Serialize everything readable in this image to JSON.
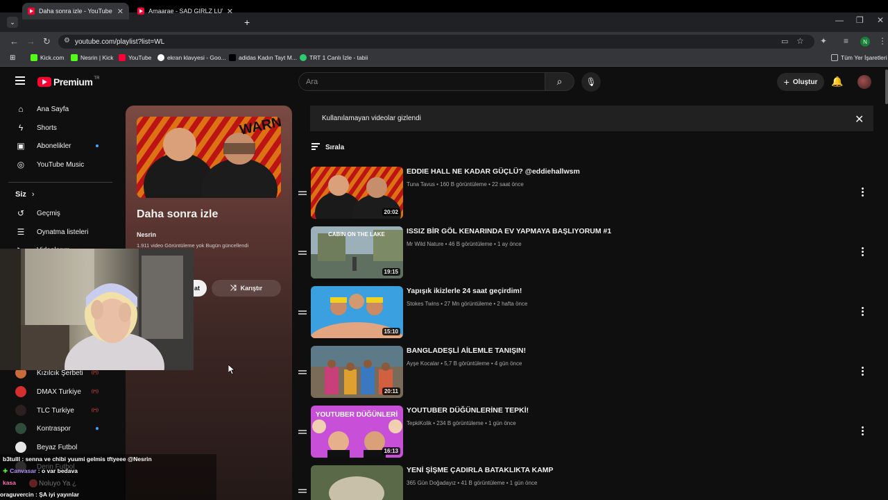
{
  "browser": {
    "tabs": [
      {
        "title": "Daha sonra izle - YouTube",
        "active": true
      },
      {
        "title": "Amaarae - SAD GIRLZ LUV MO",
        "active": false
      }
    ],
    "url": "youtube.com/playlist?list=WL",
    "bookmarks": [
      "Kick.com",
      "Nesrin | Kick",
      "YouTube",
      "ekran klavyesi - Goo...",
      "adidas Kadın Tayt M...",
      "TRT 1 Canlı İzle - tabii"
    ],
    "all_bookmarks": "Tüm Yer İşaretleri",
    "profile_initial": "N"
  },
  "header": {
    "logo_text": "Premium",
    "country": "TR",
    "search_placeholder": "Ara",
    "create_label": "Oluştur"
  },
  "sidebar": {
    "main": [
      {
        "label": "Ana Sayfa",
        "icon": "home-icon"
      },
      {
        "label": "Shorts",
        "icon": "shorts-icon"
      },
      {
        "label": "Abonelikler",
        "icon": "subscriptions-icon"
      },
      {
        "label": "YouTube Music",
        "icon": "music-icon"
      }
    ],
    "you_heading": "Siz",
    "you": [
      {
        "label": "Geçmiş",
        "icon": "history-icon"
      },
      {
        "label": "Oynatma listeleri",
        "icon": "playlists-icon"
      },
      {
        "label": "Videolarım",
        "icon": "videos-icon"
      }
    ],
    "subscriptions": [
      {
        "label": "Kızılcık Şerbeti",
        "badge": "live"
      },
      {
        "label": "DMAX Turkiye",
        "badge": "live"
      },
      {
        "label": "TLC Turkiye",
        "badge": "live"
      },
      {
        "label": "Kontraspor",
        "badge": "dot"
      },
      {
        "label": "Beyaz Futbol",
        "badge": ""
      },
      {
        "label": "Derin Futbol",
        "badge": ""
      },
      {
        "label": "Noluyo Ya ¿",
        "badge": ""
      }
    ]
  },
  "playlist": {
    "title": "Daha sonra izle",
    "owner": "Nesrin",
    "meta": "1.911 video  Görüntüleme yok  Bugün güncellendi",
    "play_all": "at",
    "shuffle": "Karıştır"
  },
  "notice": "Kullanılamayan videolar gizlendi",
  "sort_label": "Sırala",
  "videos": [
    {
      "title": "EDDIE HALL NE KADAR GÜÇLÜ? @eddiehallwsm",
      "meta": "Tuna Tavus • 160 B görüntüleme • 22 saat önce",
      "duration": "20:02",
      "thumb": "warning"
    },
    {
      "title": "ISSIZ BİR GÖL KENARINDA EV YAPMAYA BAŞLIYORUM #1",
      "meta": "Mr Wild Nature • 46 B görüntüleme • 1 ay önce",
      "duration": "19:15",
      "thumb": "lake"
    },
    {
      "title": "Yapışık ikizlerle 24 saat geçirdim!",
      "meta": "Stokes Twins • 27 Mn görüntüleme • 2 hafta önce",
      "duration": "15:10",
      "thumb": "sky"
    },
    {
      "title": "BANGLADEŞLİ AİLEMLE TANIŞIN!",
      "meta": "Ayşe Kocalar • 5,7 B görüntüleme • 4 gün önce",
      "duration": "20:11",
      "thumb": "family"
    },
    {
      "title": "YOUTUBER DÜĞÜNLERİNE TEPKİ!",
      "meta": "TepkiKolik • 234 B görüntüleme • 1 gün önce",
      "duration": "16:13",
      "thumb": "pink"
    },
    {
      "title": "YENİ ŞİŞME ÇADIRLA BATAKLIKTA KAMP",
      "meta": "365 Gün Doğadayız • 41 B görüntüleme • 1 gün önce",
      "duration": "",
      "thumb": "green"
    }
  ],
  "chat": [
    {
      "user": "b3tulll",
      "text": " : senna ve chibi yuumi gelmis tftyeee @Nesrin",
      "color": "#ffffff"
    },
    {
      "user": "Canvasar",
      "text": " : o var bedava",
      "color": "#b68cff"
    },
    {
      "user": "kasa",
      "text": "",
      "color": "#ff6fb5"
    },
    {
      "user": "oraguvercin",
      "text": " : ŞA  iyi yayınlar",
      "color": "#ffffff"
    }
  ],
  "thumb_text": {
    "warning": "WARNING",
    "lake": "CABIN ON THE LAKE",
    "pink": "YOUTUBER DÜĞÜNLERİ"
  }
}
